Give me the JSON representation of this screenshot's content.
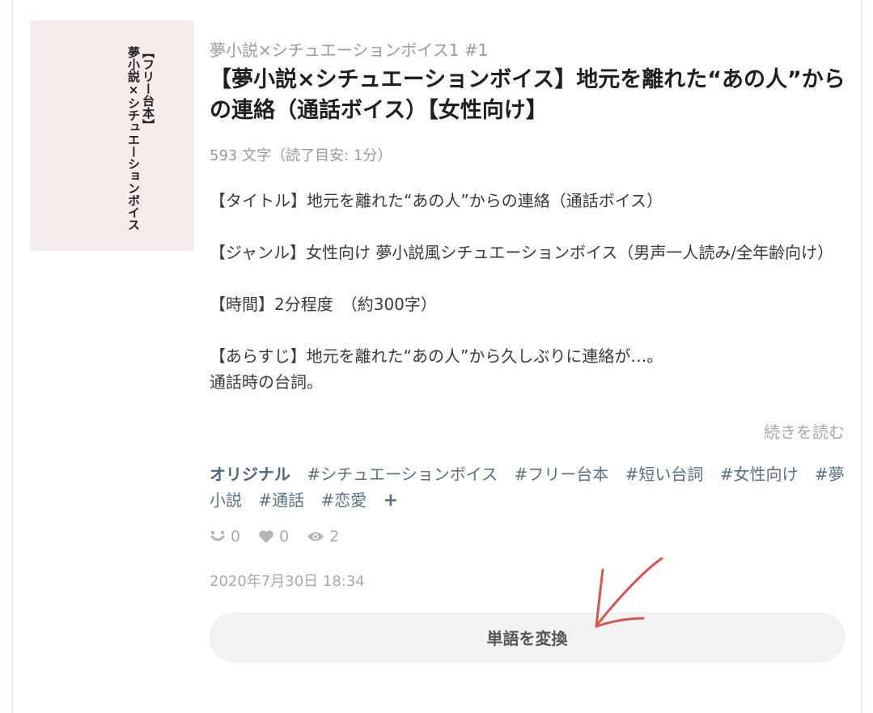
{
  "thumbnail": {
    "line1": "【フリー台本】",
    "line2": "夢小説×シチュエーションボイス"
  },
  "series": "夢小説×シチュエーションボイス1 #1",
  "title": "【夢小説×シチュエーションボイス】地元を離れた“あの人”からの連絡（通話ボイス）【女性向け】",
  "count": "593 文字（読了目安: 1分）",
  "description": {
    "line1": "【タイトル】地元を離れた“あの人”からの連絡（通話ボイス）",
    "line2": "【ジャンル】女性向け 夢小説風シチュエーションボイス（男声一人読み/全年齢向け）",
    "line3": "【時間】2分程度　（約300字）",
    "line4": "【あらすじ】地元を離れた“あの人”から久しぶりに連絡が…。",
    "line5": "通話時の台詞。"
  },
  "read_more": "続きを読む",
  "tags": {
    "original": "オリジナル",
    "items": [
      "#シチュエーションボイス",
      "#フリー台本",
      "#短い台詞",
      "#女性向け",
      "#夢小説",
      "#通話",
      "#恋愛"
    ],
    "more": "+"
  },
  "stats": {
    "reactions": "0",
    "likes": "0",
    "views": "2",
    "icons": [
      "reaction-icon",
      "heart-icon",
      "eye-icon"
    ]
  },
  "date": "2020年7月30日 18:34",
  "convert_button": "単語を変換",
  "colors": {
    "tag": "#5a7185",
    "muted": "#a9a9a9",
    "thumbnail_bg": "#f6ecec",
    "annotation_arrow": "#d9534f"
  }
}
